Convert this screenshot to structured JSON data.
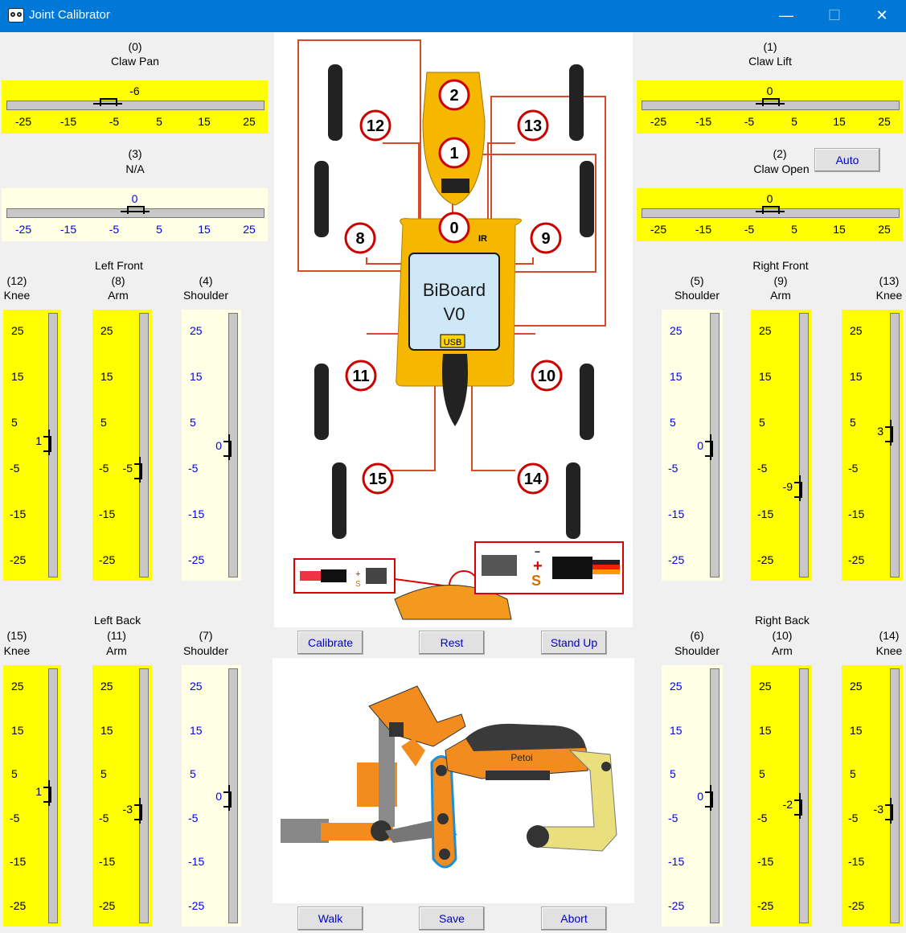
{
  "window": {
    "title": "Joint Calibrator",
    "minimize": "—",
    "maximize": "☐",
    "close": "✕"
  },
  "top_sliders": {
    "claw_pan": {
      "index": "(0)",
      "name": "Claw Pan",
      "value": "-6",
      "ticks": [
        "-25",
        "-15",
        "-5",
        "5",
        "15",
        "25"
      ]
    },
    "na": {
      "index": "(3)",
      "name": "N/A",
      "value": "0",
      "ticks": [
        "-25",
        "-15",
        "-5",
        "5",
        "15",
        "25"
      ]
    },
    "claw_lift": {
      "index": "(1)",
      "name": "Claw Lift",
      "value": "0",
      "ticks": [
        "-25",
        "-15",
        "-5",
        "5",
        "15",
        "25"
      ]
    },
    "claw_open": {
      "index": "(2)",
      "name": "Claw Open",
      "value": "0",
      "ticks": [
        "-25",
        "-15",
        "-5",
        "5",
        "15",
        "25"
      ]
    }
  },
  "auto_button": "Auto",
  "groups": {
    "left_front": "Left Front",
    "right_front": "Right Front",
    "left_back": "Left Back",
    "right_back": "Right Back"
  },
  "vticks": [
    "25",
    "15",
    "5",
    "-5",
    "-15",
    "-25"
  ],
  "joints": {
    "lf_knee": {
      "index": "(12)",
      "name": "Knee",
      "value": "1"
    },
    "lf_arm": {
      "index": "(8)",
      "name": "Arm",
      "value": "-5"
    },
    "lf_shoulder": {
      "index": "(4)",
      "name": "Shoulder",
      "value": "0"
    },
    "rf_shoulder": {
      "index": "(5)",
      "name": "Shoulder",
      "value": "0"
    },
    "rf_arm": {
      "index": "(9)",
      "name": "Arm",
      "value": "-9"
    },
    "rf_knee": {
      "index": "(13)",
      "name": "Knee",
      "value": "3"
    },
    "lb_knee": {
      "index": "(15)",
      "name": "Knee",
      "value": "1"
    },
    "lb_arm": {
      "index": "(11)",
      "name": "Arm",
      "value": "-3"
    },
    "lb_shoulder": {
      "index": "(7)",
      "name": "Shoulder",
      "value": "0"
    },
    "rb_shoulder": {
      "index": "(6)",
      "name": "Shoulder",
      "value": "0"
    },
    "rb_arm": {
      "index": "(10)",
      "name": "Arm",
      "value": "-2"
    },
    "rb_knee": {
      "index": "(14)",
      "name": "Knee",
      "value": "-3"
    }
  },
  "buttons": {
    "calibrate": "Calibrate",
    "rest": "Rest",
    "stand_up": "Stand Up",
    "walk": "Walk",
    "save": "Save",
    "abort": "Abort"
  },
  "diagram": {
    "board_name": "BiBoard",
    "board_version": "V0",
    "usb": "USB",
    "ir": "IR",
    "servo_numbers": [
      "0",
      "1",
      "2",
      "8",
      "9",
      "10",
      "11",
      "12",
      "13",
      "14",
      "15"
    ],
    "plus_label": "+",
    "minus_label": "−",
    "signal_label": "S",
    "robot_brand": "Petoi"
  }
}
